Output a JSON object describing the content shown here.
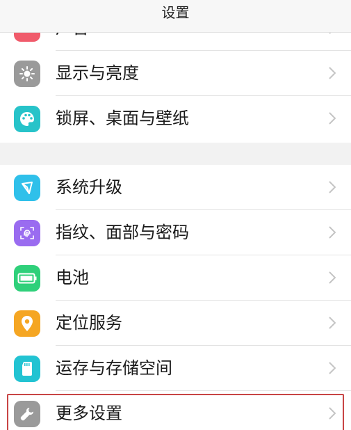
{
  "header": {
    "title": "设置"
  },
  "items_top": [
    {
      "label": "声音",
      "icon": "sound-icon",
      "color": "#f05b6b"
    },
    {
      "label": "显示与亮度",
      "icon": "brightness-icon",
      "color": "#9a9a9a"
    },
    {
      "label": "锁屏、桌面与壁纸",
      "icon": "palette-icon",
      "color": "#27c3c9"
    }
  ],
  "items_bottom": [
    {
      "label": "系统升级",
      "icon": "system-update-icon",
      "color": "#2fc0ea"
    },
    {
      "label": "指纹、面部与密码",
      "icon": "fingerprint-icon",
      "color": "#9a6cf0"
    },
    {
      "label": "电池",
      "icon": "battery-icon",
      "color": "#2fd07a"
    },
    {
      "label": "定位服务",
      "icon": "location-icon",
      "color": "#f5a623"
    },
    {
      "label": "运存与存储空间",
      "icon": "storage-icon",
      "color": "#22c3d2"
    },
    {
      "label": "更多设置",
      "icon": "wrench-icon",
      "color": "#9a9a9a"
    }
  ],
  "highlight_color": "#c84545"
}
